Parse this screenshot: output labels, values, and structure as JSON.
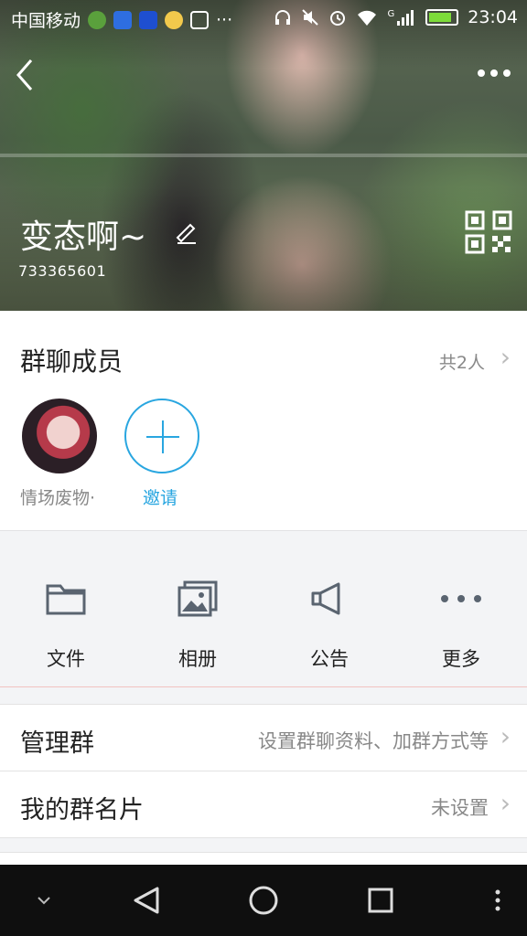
{
  "status_bar": {
    "carrier": "中国移动",
    "time": "23:04",
    "network_label": "G",
    "icons": [
      "wechat-icon",
      "baidu-cloud-icon",
      "baidu-icon",
      "lightbulb-icon",
      "image-icon",
      "ellipsis-icon",
      "headphones-icon",
      "mute-icon",
      "alarm-icon",
      "wifi-icon",
      "signal-icon",
      "battery-icon"
    ]
  },
  "header": {
    "back_icon": "chevron-left-icon",
    "more_icon": "more-dots-icon",
    "group_name": "变态啊~",
    "group_id": "733365601",
    "edit_icon": "pencil-icon",
    "qr_icon": "qr-code-icon"
  },
  "members": {
    "title": "群聊成员",
    "count_text": "共2人",
    "member_name": "情场废物·",
    "invite_label": "邀请",
    "accent": "#29a6e0"
  },
  "tools": [
    {
      "label": "文件",
      "icon": "folder-icon"
    },
    {
      "label": "相册",
      "icon": "photo-album-icon"
    },
    {
      "label": "公告",
      "icon": "megaphone-icon"
    },
    {
      "label": "更多",
      "icon": "more-dots-icon"
    }
  ],
  "rows": {
    "manage": {
      "title": "管理群",
      "value": "设置群聊资料、加群方式等"
    },
    "card": {
      "title": "我的群名片",
      "value": "未设置"
    }
  },
  "navbar": {
    "icons": [
      "chevron-down-icon",
      "back-triangle-icon",
      "home-circle-icon",
      "recents-square-icon",
      "menu-dots-icon"
    ]
  }
}
